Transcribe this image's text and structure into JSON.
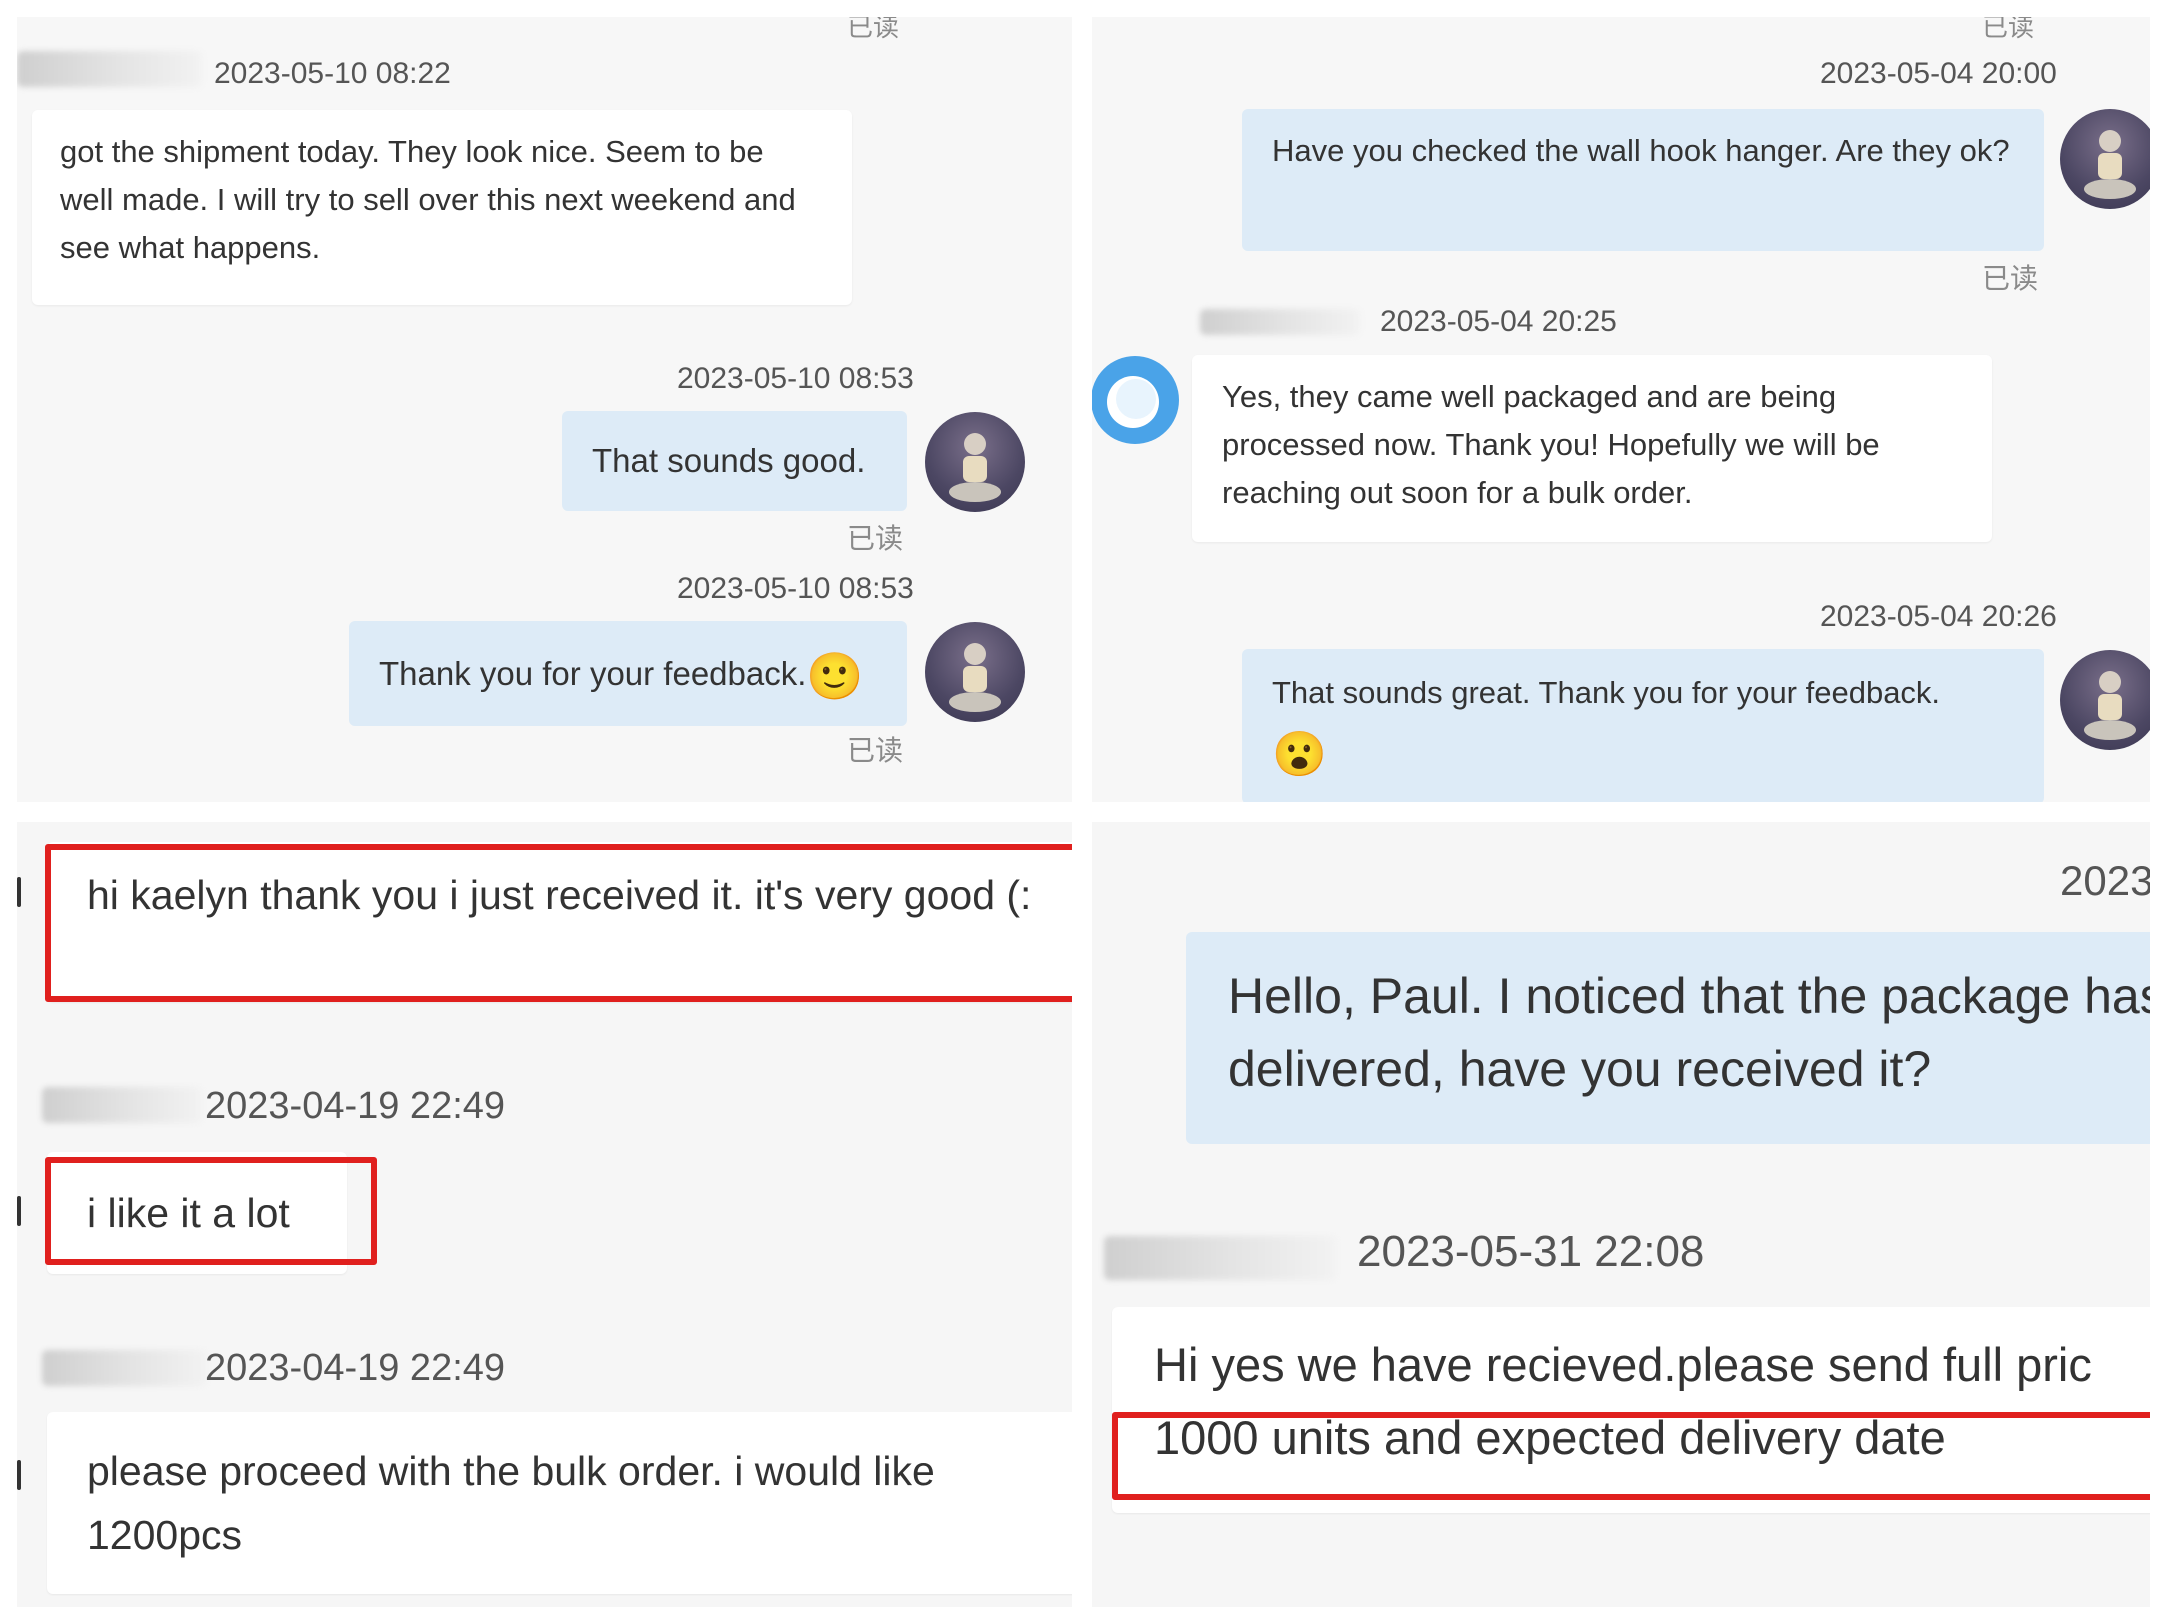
{
  "panel_top_left": {
    "cropped_read": "已读",
    "incoming_time": "2023-05-10 08:22",
    "incoming_text": "got the shipment today. They look nice. Seem to be well made. I will try to sell over this next weekend and see what happens.",
    "reply1_time": "2023-05-10 08:53",
    "reply1_text": "That sounds good.",
    "reply1_status": "已读",
    "reply2_time": "2023-05-10 08:53",
    "reply2_text": "Thank you for your feedback.",
    "reply2_emoji": "🙂",
    "reply2_status": "已读"
  },
  "panel_top_right": {
    "cropped_read": "已读",
    "out1_time": "2023-05-04 20:00",
    "out1_text": "Have you checked the wall hook hanger. Are they ok?",
    "out1_status": "已读",
    "incoming_time": "2023-05-04 20:25",
    "incoming_text": "Yes, they came well packaged and are being processed now. Thank you! Hopefully we will be reaching out soon for a bulk order.",
    "out2_time": "2023-05-04 20:26",
    "out2_text": "That sounds great. Thank you for your feedback.",
    "out2_emoji": "😮"
  },
  "panel_bottom_left": {
    "msg1_text": "hi kaelyn thank you i just received it. it's very good (:",
    "msg2_time": "2023-04-19 22:49",
    "msg2_text": "i like it a lot",
    "msg3_time": "2023-04-19 22:49",
    "msg3_text": "please proceed with the bulk order. i would like 1200pcs"
  },
  "panel_bottom_right": {
    "top_time_fragment": "2023",
    "out_text_line1": "Hello, Paul. I noticed that the package has",
    "out_text_line2": "delivered, have you received it?",
    "incoming_time": "2023-05-31 22:08",
    "incoming_line1": "Hi yes we have recieved.please send full pric",
    "incoming_line2": "1000 units and expected delivery date"
  },
  "colors": {
    "highlight": "#e0201e",
    "outgoing_bubble": "#ddebf7",
    "incoming_bubble": "#ffffff"
  }
}
